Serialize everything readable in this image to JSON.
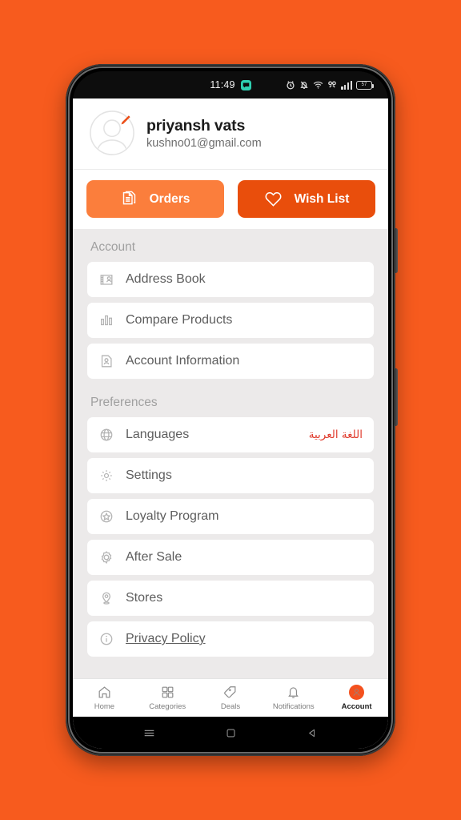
{
  "background_color": "#F75B1E",
  "status_bar": {
    "time": "11:49",
    "battery_level": "57",
    "icons": [
      "chat-badge-icon",
      "alarm-icon",
      "bell-mute-icon",
      "wifi-icon",
      "vpn-key-icon",
      "signal-bars-icon",
      "battery-icon"
    ]
  },
  "profile": {
    "name": "priyansh vats",
    "email": "kushno01@gmail.com",
    "avatar_icon": "avatar-placeholder-icon",
    "edit_icon": "pencil-icon"
  },
  "actions": {
    "orders": {
      "label": "Orders",
      "icon": "documents-icon",
      "color": "#FB7E3C"
    },
    "wishlist": {
      "label": "Wish List",
      "icon": "heart-icon",
      "color": "#E94E0C"
    }
  },
  "sections": [
    {
      "title": "Account",
      "items": [
        {
          "label": "Address Book",
          "icon": "address-card-icon"
        },
        {
          "label": "Compare Products",
          "icon": "bar-chart-icon"
        },
        {
          "label": "Account Information",
          "icon": "document-person-icon"
        }
      ]
    },
    {
      "title": "Preferences",
      "items": [
        {
          "label": "Languages",
          "icon": "globe-icon",
          "trailing": "اللغة العربية",
          "trailing_color": "#E03C2E"
        },
        {
          "label": "Settings",
          "icon": "gear-icon"
        },
        {
          "label": "Loyalty Program",
          "icon": "star-circle-icon"
        },
        {
          "label": "After Sale",
          "icon": "gear-outline-icon"
        },
        {
          "label": "Stores",
          "icon": "map-pin-icon"
        },
        {
          "label": "Privacy Policy",
          "icon": "info-circle-icon",
          "underline": true
        }
      ]
    }
  ],
  "tabbar": {
    "items": [
      {
        "label": "Home",
        "icon": "home-icon",
        "active": false
      },
      {
        "label": "Categories",
        "icon": "grid-icon",
        "active": false
      },
      {
        "label": "Deals",
        "icon": "tag-icon",
        "active": false
      },
      {
        "label": "Notifications",
        "icon": "bell-icon",
        "active": false
      },
      {
        "label": "Account",
        "icon": "account-person-icon",
        "active": true
      }
    ]
  },
  "android_nav": {
    "recents_icon": "menu-icon",
    "home_icon": "square-icon",
    "back_icon": "triangle-back-icon"
  }
}
